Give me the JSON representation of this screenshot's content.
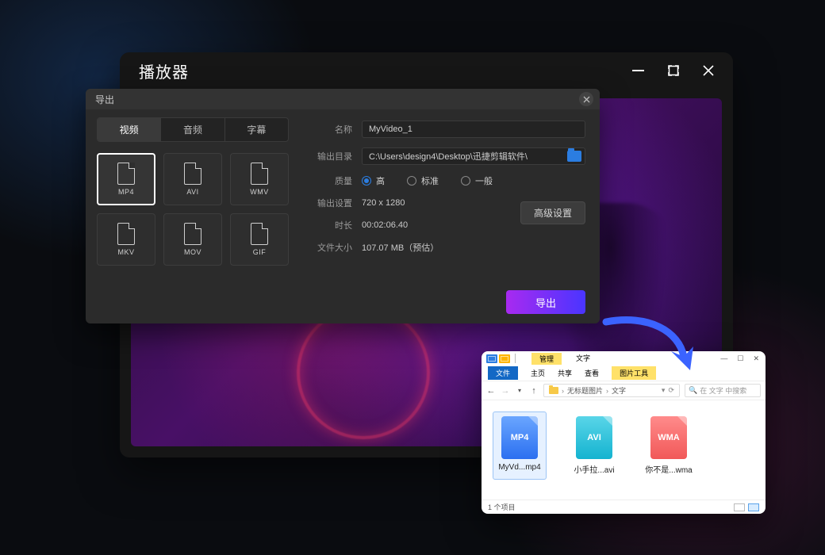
{
  "player": {
    "title": "播放器"
  },
  "export": {
    "dialog_title": "导出",
    "tabs": {
      "video": "视频",
      "audio": "音频",
      "subtitle": "字幕"
    },
    "formats": {
      "mp4": "MP4",
      "avi": "AVI",
      "wmv": "WMV",
      "mkv": "MKV",
      "mov": "MOV",
      "gif": "GIF"
    },
    "labels": {
      "name": "名称",
      "output_dir": "输出目录",
      "quality": "质量",
      "output_setting": "输出设置",
      "duration": "时长",
      "file_size": "文件大小"
    },
    "values": {
      "name": "MyVideo_1",
      "output_dir": "C:\\Users\\design4\\Desktop\\迅捷剪辑软件\\",
      "resolution": "720 x 1280",
      "duration": "00:02:06.40",
      "file_size": "107.07 MB（预估）"
    },
    "quality_options": {
      "high": "高",
      "standard": "标准",
      "normal": "一般"
    },
    "advanced_label": "高级设置",
    "export_label": "导出"
  },
  "explorer": {
    "ribbon_manage": "管理",
    "title": "文字",
    "ribbon": {
      "file": "文件",
      "home": "主页",
      "share": "共享",
      "view": "查看",
      "pic_tools": "图片工具"
    },
    "breadcrumb": {
      "root": "无标题图片",
      "leaf": "文字"
    },
    "search_placeholder": "在 文字 中搜索",
    "files": {
      "f1": {
        "badge": "MP4",
        "name": "MyVd...mp4"
      },
      "f2": {
        "badge": "AVI",
        "name": "小手拉...avi"
      },
      "f3": {
        "badge": "WMA",
        "name": "你不是...wma"
      }
    },
    "status": "1 个项目"
  }
}
